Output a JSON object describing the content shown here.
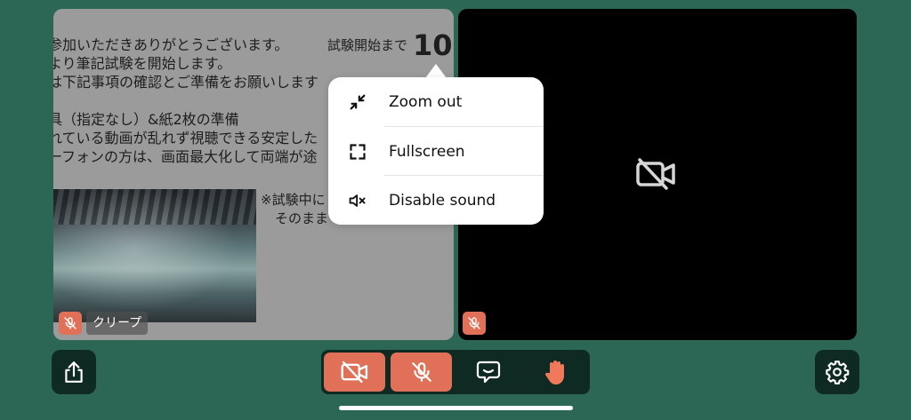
{
  "left_tile": {
    "doc_lines": [
      "参加いただきありがとうございます。",
      "より筆記試験を開始します。",
      "は下記事項の確認とご準備をお願いします",
      "",
      "具（指定なし）&紙2枚の準備",
      "れている動画が乱れず視聴できる安定した",
      "ーフォンの方は、画面最大化して両端が途"
    ],
    "countdown_label": "試験開始まで",
    "countdown_value": "10",
    "note_lines": [
      "※試験中に",
      "そのまま"
    ],
    "participant_name": "クリープ",
    "mic_state": "muted"
  },
  "right_tile": {
    "camera_state": "off",
    "mic_state": "muted"
  },
  "popup_menu": {
    "items": [
      {
        "label": "Zoom out",
        "icon": "zoom-out-icon"
      },
      {
        "label": "Fullscreen",
        "icon": "fullscreen-icon"
      },
      {
        "label": "Disable sound",
        "icon": "speaker-muted-icon"
      }
    ]
  },
  "toolbar": {
    "share_icon": "share-icon",
    "camera_icon": "camera-off-icon",
    "mic_icon": "mic-off-icon",
    "chat_icon": "chat-icon",
    "hand_icon": "raise-hand-icon",
    "settings_icon": "gear-icon"
  },
  "colors": {
    "background": "#2b6754",
    "control_dark": "#0e2a22",
    "accent": "#e07158",
    "hand": "#f0795c"
  }
}
